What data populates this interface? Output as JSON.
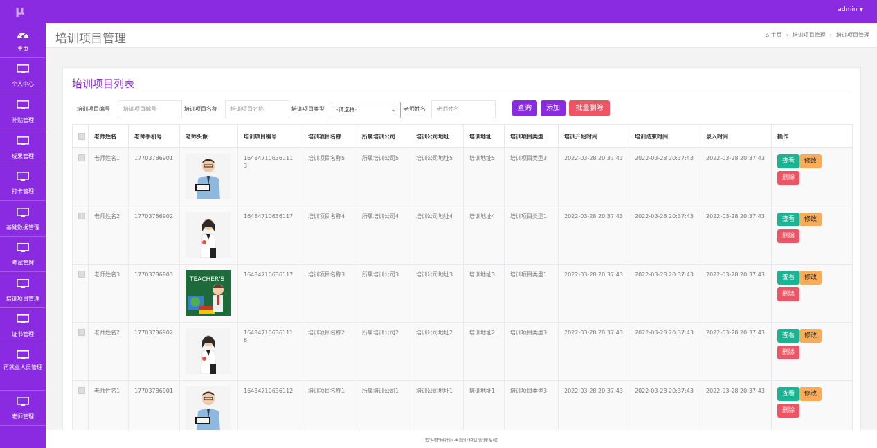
{
  "app": {
    "logo": "μ",
    "user": "admin"
  },
  "sidebar": {
    "items": [
      {
        "label": "主页",
        "icon": "dashboard-icon"
      },
      {
        "label": "个人中心",
        "icon": "monitor-icon"
      },
      {
        "label": "补贴管理",
        "icon": "monitor-icon"
      },
      {
        "label": "成果管理",
        "icon": "monitor-icon"
      },
      {
        "label": "打卡管理",
        "icon": "monitor-icon"
      },
      {
        "label": "基础数据管理",
        "icon": "monitor-icon"
      },
      {
        "label": "考试管理",
        "icon": "monitor-icon"
      },
      {
        "label": "培训项目管理",
        "icon": "monitor-icon"
      },
      {
        "label": "证书管理",
        "icon": "monitor-icon"
      },
      {
        "label": "再就业人员管理",
        "icon": "monitor-icon"
      },
      {
        "label": "老师管理",
        "icon": "monitor-icon"
      }
    ]
  },
  "header": {
    "title": "培训项目管理",
    "breadcrumb": [
      "主页",
      "培训项目管理",
      "培训项目管理"
    ]
  },
  "panel": {
    "title": "培训项目列表"
  },
  "filters": {
    "code_label": "培训项目编号",
    "code_placeholder": "培训项目编号",
    "name_label": "培训项目名称",
    "name_placeholder": "培训项目名称",
    "type_label": "培训项目类型",
    "type_selected": "-请选择-",
    "teacher_label": "老师姓名",
    "teacher_placeholder": "老师姓名"
  },
  "buttons": {
    "query": "查询",
    "add": "添加",
    "batch_delete": "批量删除"
  },
  "table": {
    "headers": [
      "老师姓名",
      "老师手机号",
      "老师头像",
      "培训项目编号",
      "培训项目名称",
      "所属培训公司",
      "培训公司地址",
      "培训地址",
      "培训项目类型",
      "培训开始时间",
      "培训结束时间",
      "录入时间",
      "操作"
    ],
    "actions": {
      "view": "查看",
      "edit": "修改",
      "delete": "删除"
    },
    "rows": [
      {
        "teacher": "老师姓名1",
        "phone": "17703786901",
        "avatar": "man",
        "code": "164847106361113",
        "name": "培训项目名称5",
        "company": "所属培训公司5",
        "company_addr": "培训公司地址5",
        "addr": "培训地址5",
        "type": "培训项目类型3",
        "start": "2022-03-28 20:37:43",
        "end": "2022-03-28 20:37:43",
        "created": "2022-03-28 20:37:43"
      },
      {
        "teacher": "老师姓名2",
        "phone": "17703786902",
        "avatar": "woman",
        "code": "16484710636117",
        "name": "培训项目名称4",
        "company": "所属培训公司4",
        "company_addr": "培训公司地址4",
        "addr": "培训地址4",
        "type": "培训项目类型1",
        "start": "2022-03-28 20:37:43",
        "end": "2022-03-28 20:37:43",
        "created": "2022-03-28 20:37:43"
      },
      {
        "teacher": "老师姓名3",
        "phone": "17703786903",
        "avatar": "teachers-day",
        "code": "16484710636117",
        "name": "培训项目名称3",
        "company": "所属培训公司3",
        "company_addr": "培训公司地址3",
        "addr": "培训地址3",
        "type": "培训项目类型1",
        "start": "2022-03-28 20:37:43",
        "end": "2022-03-28 20:37:43",
        "created": "2022-03-28 20:37:43"
      },
      {
        "teacher": "老师姓名2",
        "phone": "17703786902",
        "avatar": "woman",
        "code": "164847106361116",
        "name": "培训项目名称2",
        "company": "所属培训公司2",
        "company_addr": "培训公司地址2",
        "addr": "培训地址2",
        "type": "培训项目类型3",
        "start": "2022-03-28 20:37:43",
        "end": "2022-03-28 20:37:43",
        "created": "2022-03-28 20:37:43"
      },
      {
        "teacher": "老师姓名1",
        "phone": "17703786901",
        "avatar": "man",
        "code": "16484710636112",
        "name": "培训项目名称1",
        "company": "所属培训公司1",
        "company_addr": "培训公司地址1",
        "addr": "培训地址1",
        "type": "培训项目类型3",
        "start": "2022-03-28 20:37:43",
        "end": "2022-03-28 20:37:43",
        "created": "2022-03-28 20:37:43"
      }
    ]
  },
  "footer": {
    "text": "欢迎使用社区再就业培训管理系统"
  },
  "colors": {
    "brand": "#8a2be2",
    "view": "#1ab394",
    "edit": "#f8ac59",
    "delete": "#ed5565",
    "add": "#8a2be2",
    "query": "#8a2be2",
    "batch_delete": "#ed5565"
  }
}
